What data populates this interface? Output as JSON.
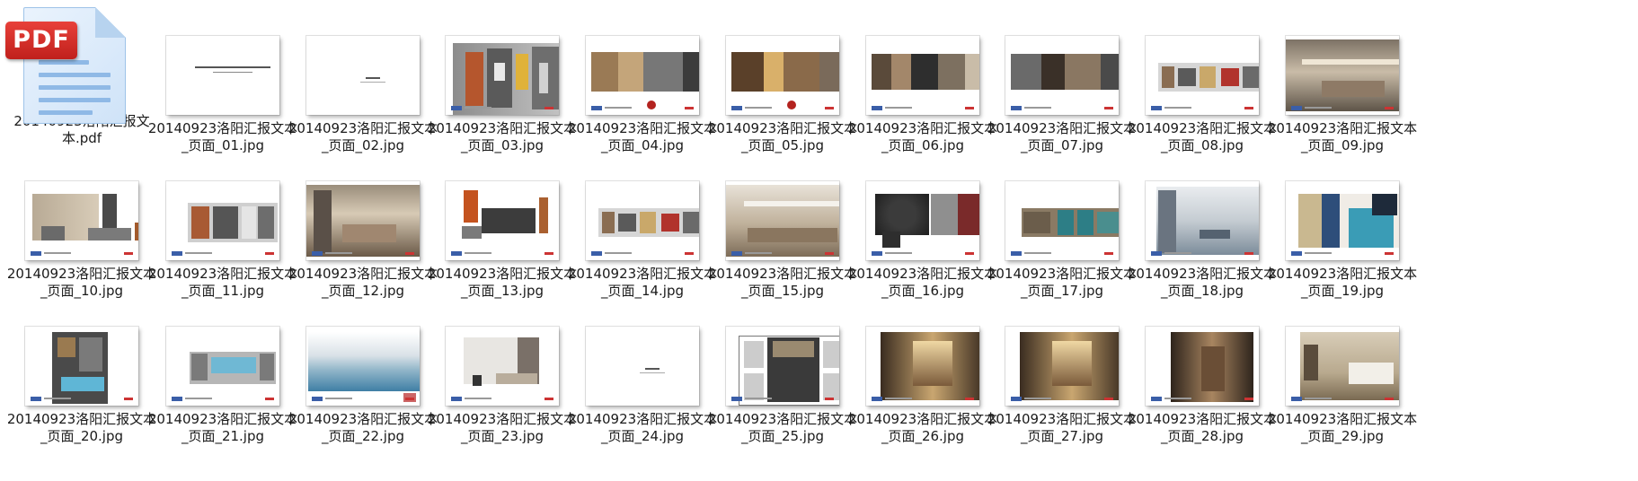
{
  "files": [
    {
      "name": "20140923洛阳汇报文本.pdf",
      "kind": "pdf",
      "badge": "PDF"
    },
    {
      "name": "20140923洛阳汇报文本_页面_01.jpg",
      "kind": "cover"
    },
    {
      "name": "20140923洛阳汇报文本_页面_02.jpg",
      "kind": "section"
    },
    {
      "name": "20140923洛阳汇报文本_页面_03.jpg",
      "kind": "plan-color"
    },
    {
      "name": "20140923洛阳汇报文本_页面_04.jpg",
      "kind": "moodboard-brown"
    },
    {
      "name": "20140923洛阳汇报文本_页面_05.jpg",
      "kind": "moodboard-gold"
    },
    {
      "name": "20140923洛阳汇报文本_页面_06.jpg",
      "kind": "interior-strip"
    },
    {
      "name": "20140923洛阳汇报文本_页面_07.jpg",
      "kind": "interior-strip-dark"
    },
    {
      "name": "20140923洛阳汇报文本_页面_08.jpg",
      "kind": "plan-wide"
    },
    {
      "name": "20140923洛阳汇报文本_页面_09.jpg",
      "kind": "render-lobby"
    },
    {
      "name": "20140923洛阳汇报文本_页面_10.jpg",
      "kind": "furniture-beige"
    },
    {
      "name": "20140923洛阳汇报文本_页面_11.jpg",
      "kind": "plan-small"
    },
    {
      "name": "20140923洛阳汇报文本_页面_12.jpg",
      "kind": "render-lounge"
    },
    {
      "name": "20140923洛阳汇报文本_页面_13.jpg",
      "kind": "furniture-orange"
    },
    {
      "name": "20140923洛阳汇报文本_页面_14.jpg",
      "kind": "plan-wide"
    },
    {
      "name": "20140923洛阳汇报文本_页面_15.jpg",
      "kind": "render-restaurant"
    },
    {
      "name": "20140923洛阳汇报文本_页面_16.jpg",
      "kind": "furniture-dark"
    },
    {
      "name": "20140923洛阳汇报文本_页面_17.jpg",
      "kind": "elevation-teal"
    },
    {
      "name": "20140923洛阳汇报文本_页面_18.jpg",
      "kind": "render-office"
    },
    {
      "name": "20140923洛阳汇报文本_页面_19.jpg",
      "kind": "moodboard-blue"
    },
    {
      "name": "20140923洛阳汇报文本_页面_20.jpg",
      "kind": "plan-pool"
    },
    {
      "name": "20140923洛阳汇报文本_页面_21.jpg",
      "kind": "plan-pool-wide"
    },
    {
      "name": "20140923洛阳汇报文本_页面_22.jpg",
      "kind": "render-pool"
    },
    {
      "name": "20140923洛阳汇报文本_页面_23.jpg",
      "kind": "furniture-light"
    },
    {
      "name": "20140923洛阳汇报文本_页面_24.jpg",
      "kind": "section"
    },
    {
      "name": "20140923洛阳汇报文本_页面_25.jpg",
      "kind": "plan-bw"
    },
    {
      "name": "20140923洛阳汇报文本_页面_26.jpg",
      "kind": "render-corridor"
    },
    {
      "name": "20140923洛阳汇报文本_页面_27.jpg",
      "kind": "render-corridor"
    },
    {
      "name": "20140923洛阳汇报文本_页面_28.jpg",
      "kind": "render-corridor-narrow"
    },
    {
      "name": "20140923洛阳汇报文本_页面_29.jpg",
      "kind": "render-bedroom"
    }
  ]
}
